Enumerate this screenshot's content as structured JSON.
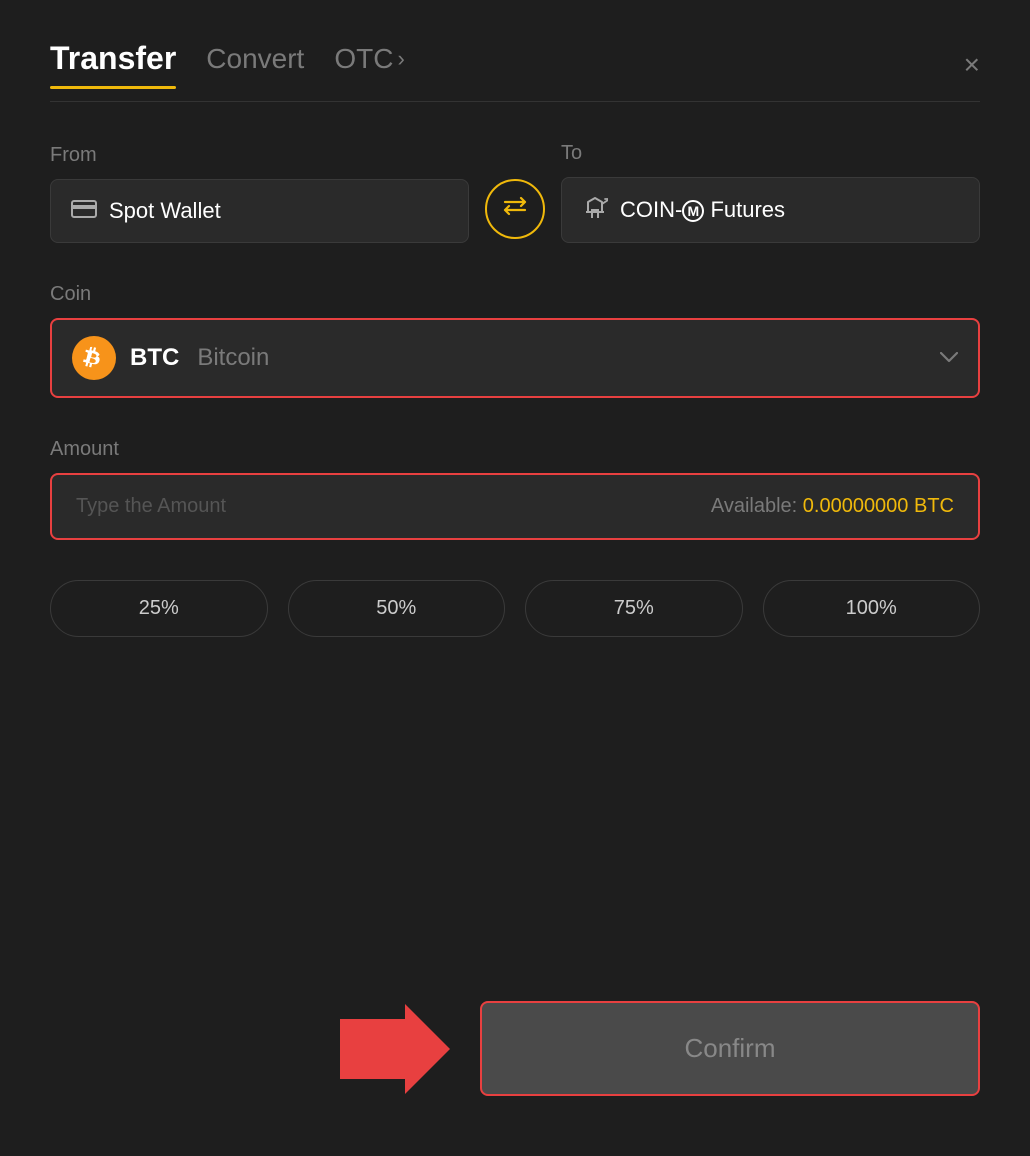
{
  "header": {
    "tab_transfer": "Transfer",
    "tab_convert": "Convert",
    "tab_otc": "OTC",
    "close_label": "×"
  },
  "from": {
    "label": "From",
    "wallet_icon": "💳",
    "wallet_name": "Spot Wallet"
  },
  "to": {
    "label": "To",
    "wallet_icon": "↑",
    "wallet_name": "COIN-Ⓜ Futures"
  },
  "coin": {
    "label": "Coin",
    "btc_symbol": "BTC",
    "btc_fullname": "Bitcoin",
    "btc_icon_letter": "₿"
  },
  "amount": {
    "label": "Amount",
    "placeholder": "Type the Amount",
    "available_label": "Available:",
    "available_value": "0.00000000 BTC"
  },
  "percent_buttons": [
    {
      "label": "25%"
    },
    {
      "label": "50%"
    },
    {
      "label": "75%"
    },
    {
      "label": "100%"
    }
  ],
  "confirm_button": {
    "label": "Confirm"
  },
  "colors": {
    "accent_yellow": "#f0b90b",
    "accent_red": "#e84040",
    "bg_dark": "#1e1e1e",
    "bg_input": "#2a2a2a",
    "text_muted": "#7a7a7a",
    "text_light": "#ffffff"
  }
}
